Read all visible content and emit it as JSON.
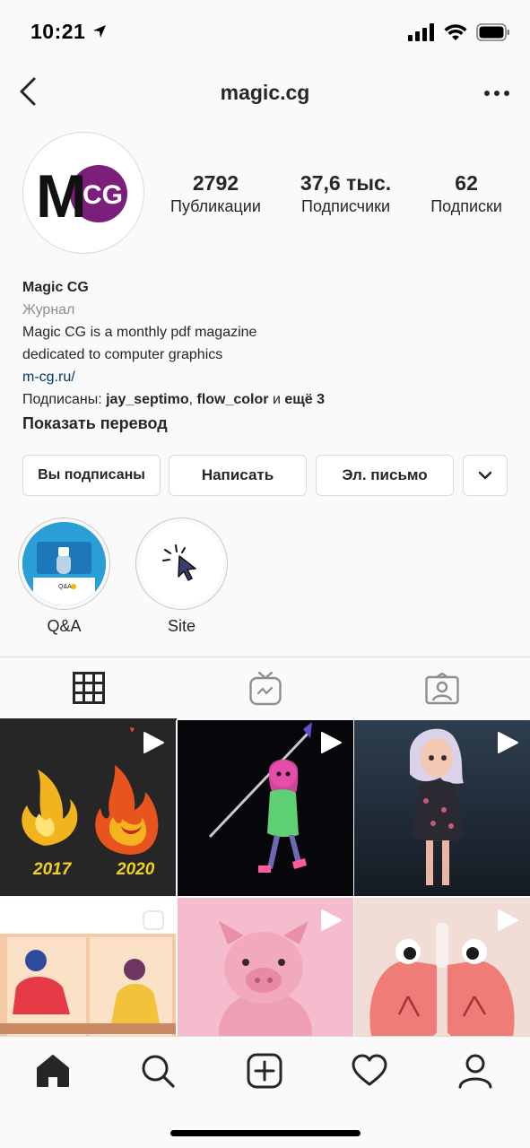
{
  "status": {
    "time": "10:21"
  },
  "nav": {
    "username": "magic.cg"
  },
  "profile": {
    "avatar_text_m": "M",
    "avatar_text_cg": "CG",
    "stats": [
      {
        "value": "2792",
        "label": "Публикации"
      },
      {
        "value": "37,6 тыс.",
        "label": "Подписчики"
      },
      {
        "value": "62",
        "label": "Подписки"
      }
    ],
    "name": "Magic CG",
    "category": "Журнал",
    "bio_line1": "Magic CG is a monthly pdf magazine",
    "bio_line2": "dedicated to computer graphics",
    "link": "m-cg.ru/",
    "followed_prefix": "Подписаны: ",
    "followed_user1": "jay_septimo",
    "followed_sep": ", ",
    "followed_user2": "flow_color",
    "followed_and": " и ",
    "followed_more": "ещё 3",
    "show_translation": "Показать перевод"
  },
  "actions": {
    "following": "Вы подписаны",
    "message": "Написать",
    "email": "Эл. письмо"
  },
  "highlights": [
    {
      "label": "Q&A",
      "inner_text": "Q&A"
    },
    {
      "label": "Site"
    }
  ],
  "posts": [
    {
      "type": "video",
      "year_left": "2017",
      "year_right": "2020"
    },
    {
      "type": "video"
    },
    {
      "type": "video"
    },
    {
      "type": "video"
    },
    {
      "type": "video"
    },
    {
      "type": "video"
    }
  ],
  "colors": {
    "accent_purple": "#7b1f7a",
    "text": "#262626",
    "secondary": "#8e8e8e",
    "link": "#00376b",
    "border": "#dbdbdb"
  }
}
